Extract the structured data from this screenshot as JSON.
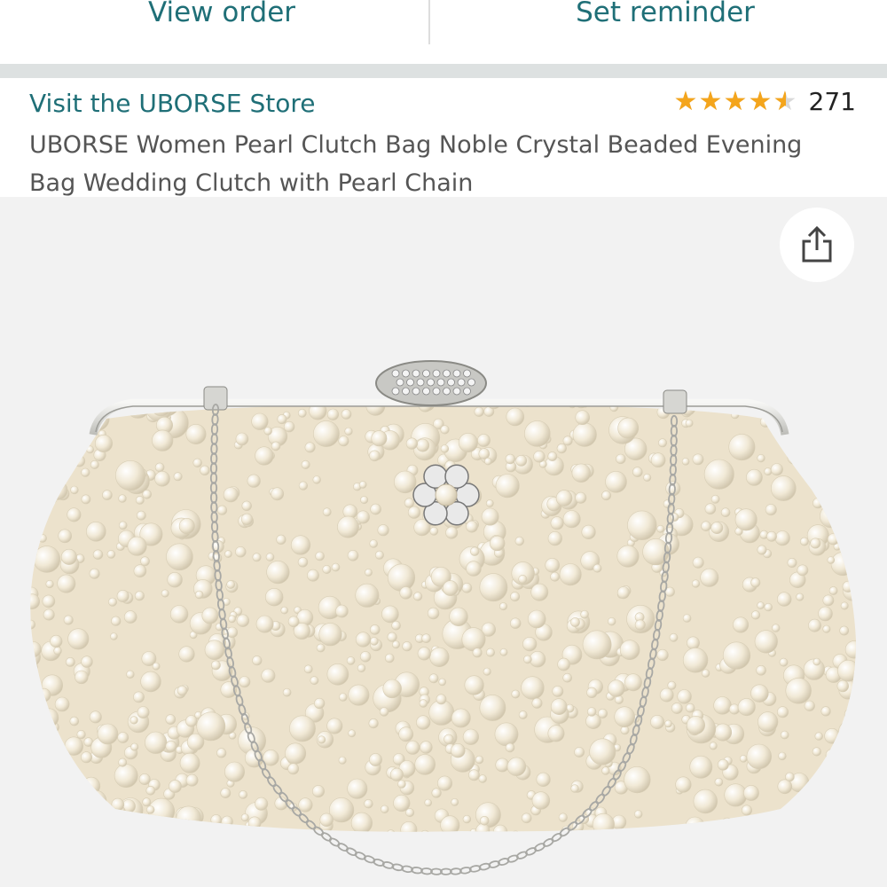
{
  "actions": {
    "view_order": "View order",
    "set_reminder": "Set reminder"
  },
  "store": {
    "link_label": "Visit the UBORSE Store"
  },
  "rating": {
    "stars": 4.5,
    "count": "271"
  },
  "product": {
    "title": "UBORSE Women Pearl Clutch Bag Noble Crystal Beaded Evening Bag Wedding Clutch with Pearl Chain"
  },
  "icons": {
    "share": "share-icon",
    "star": "star-icon"
  },
  "colors": {
    "link": "#1f6f77",
    "star": "#f4a51c",
    "image_bg": "#f2f2f2",
    "pearl": "#f3ecdc"
  }
}
